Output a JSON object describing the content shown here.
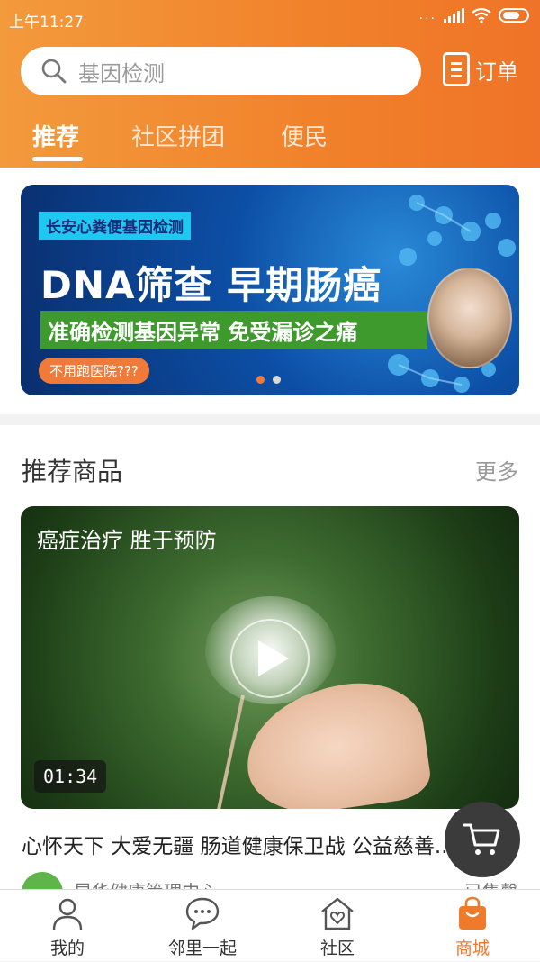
{
  "status_bar": {
    "time": "上午11:27",
    "dots": "..."
  },
  "search": {
    "placeholder": "基因检测"
  },
  "order": {
    "label": "订单"
  },
  "tabs": [
    {
      "label": "推荐",
      "active": true
    },
    {
      "label": "社区拼团",
      "active": false
    },
    {
      "label": "便民",
      "active": false
    }
  ],
  "banner": {
    "tag": "长安心粪便基因检测",
    "title": "DNA筛查  早期肠癌",
    "subtitle": "准确检测基因异常  免受漏诊之痛",
    "pill": "不用跑医院???",
    "active_dot_index": 0,
    "dot_count": 2
  },
  "recommended": {
    "section_title": "推荐商品",
    "more_label": "更多",
    "video": {
      "caption": "癌症治疗 胜于预防",
      "duration": "01:34"
    },
    "item_title": "心怀天下 大爱无疆 肠道健康保卫战 公益慈善...",
    "seller": "昆华健康管理中心",
    "sales": "已售罄"
  },
  "tabbar": [
    {
      "label": "我的",
      "icon": "person-icon",
      "active": false
    },
    {
      "label": "邻里一起",
      "icon": "chat-icon",
      "active": false
    },
    {
      "label": "社区",
      "icon": "home-heart-icon",
      "active": false
    },
    {
      "label": "商城",
      "icon": "shopping-bag-icon",
      "active": true
    }
  ],
  "colors": {
    "accent": "#ef7a2a",
    "header_start": "#f39a3c",
    "header_end": "#ef7328"
  }
}
